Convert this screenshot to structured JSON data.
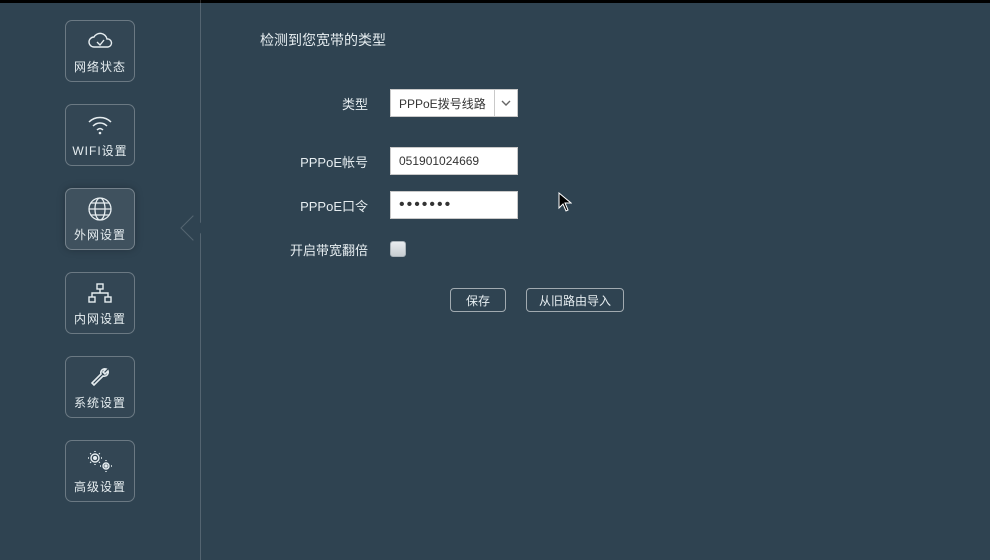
{
  "sidebar": {
    "items": [
      {
        "id": "status",
        "label": "网络状态",
        "icon": "cloud-icon"
      },
      {
        "id": "wifi",
        "label": "WIFI设置",
        "icon": "wifi-icon"
      },
      {
        "id": "wan",
        "label": "外网设置",
        "icon": "globe-icon",
        "active": true
      },
      {
        "id": "lan",
        "label": "内网设置",
        "icon": "lan-icon"
      },
      {
        "id": "system",
        "label": "系统设置",
        "icon": "wrench-icon"
      },
      {
        "id": "advanced",
        "label": "高级设置",
        "icon": "gears-icon"
      }
    ]
  },
  "page": {
    "title": "检测到您宽带的类型",
    "type_label": "类型",
    "type_value": "PPPoE拨号线路",
    "account_label": "PPPoE帐号",
    "account_value": "051901024669",
    "password_label": "PPPoE口令",
    "password_value": "●●●●●●●",
    "boost_label": "开启带宽翻倍",
    "boost_checked": false,
    "save_button": "保存",
    "import_button": "从旧路由导入"
  }
}
